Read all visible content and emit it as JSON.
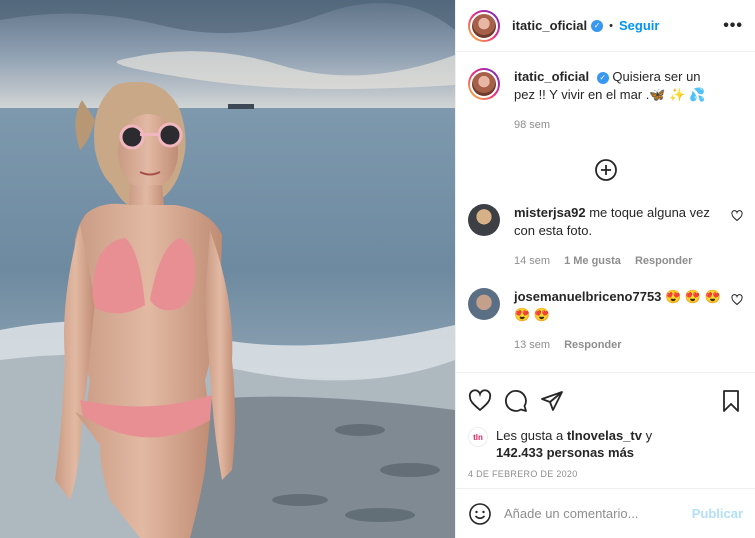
{
  "post": {
    "username": "itatic_oficial",
    "follow_label": "Seguir",
    "more_label": "•••",
    "dot_separator": "•"
  },
  "caption": {
    "username": "itatic_oficial",
    "text": "Quisiera ser un pez !! Y vivir en el mar .🦋 ✨ 💦",
    "time": "98 sem"
  },
  "comments": [
    {
      "username": "misterjsa92",
      "text": "me toque alguna vez con esta foto.",
      "time": "14 sem",
      "likes": "1 Me gusta",
      "reply": "Responder"
    },
    {
      "username": "josemanuelbriceno7753",
      "text": "😍 😍 😍 😍 😍",
      "time": "13 sem",
      "reply": "Responder"
    }
  ],
  "likes": {
    "prefix": "Les gusta a",
    "user": "tlnovelas_tv",
    "and": "y",
    "count": "142.433 personas más",
    "badge": "tln"
  },
  "date": "4 DE FEBRERO DE 2020",
  "comment_box": {
    "placeholder": "Añade un comentario...",
    "publish": "Publicar"
  },
  "colors": {
    "accent": "#0095f6",
    "verified": "#3897f0",
    "muted": "#8e8e8e"
  }
}
